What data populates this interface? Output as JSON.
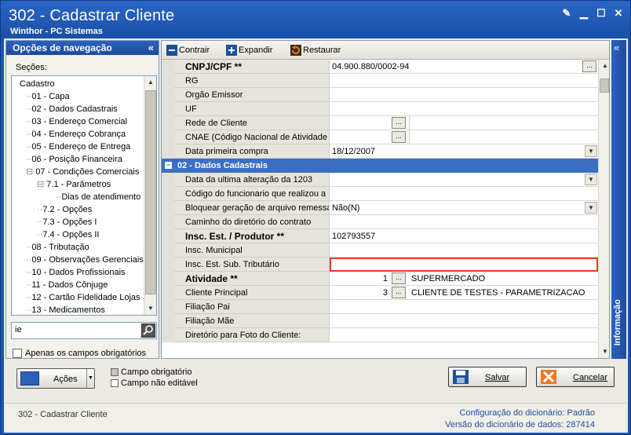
{
  "window": {
    "title": "302 - Cadastrar Cliente",
    "subtitle": "Winthor - PC Sistemas"
  },
  "nav": {
    "header": "Opções de navegação",
    "sections_label": "Seções:",
    "tree": [
      {
        "label": "Cadastro",
        "level": 0
      },
      {
        "label": "01 - Capa",
        "level": 1
      },
      {
        "label": "02 - Dados Cadastrais",
        "level": 1
      },
      {
        "label": "03 - Endereço Comercial",
        "level": 1
      },
      {
        "label": "04 - Endereço Cobrança",
        "level": 1
      },
      {
        "label": "05 - Endereço de Entrega",
        "level": 1
      },
      {
        "label": "06 - Posição Financeira",
        "level": 1
      },
      {
        "label": "07 - Condições Comerciais",
        "level": 1
      },
      {
        "label": "7.1 - Parâmetros",
        "level": 2
      },
      {
        "label": "Dias de atendimento",
        "level": 3
      },
      {
        "label": "7.2 - Opções",
        "level": 2
      },
      {
        "label": "7.3 - Opções I",
        "level": 2
      },
      {
        "label": "7.4 - Opções II",
        "level": 2
      },
      {
        "label": "08 - Tributação",
        "level": 1
      },
      {
        "label": "09 - Observações Gerenciais",
        "level": 1
      },
      {
        "label": "10 - Dados Profissionais",
        "level": 1
      },
      {
        "label": "11 - Dados Cônjuge",
        "level": 1
      },
      {
        "label": "12 - Cartão Fidelidade Lojas",
        "level": 1
      },
      {
        "label": "13 - Medicamentos",
        "level": 1
      }
    ],
    "search_value": "ie",
    "only_required_label": "Apenas os campos obrigatórios"
  },
  "toolbar": {
    "collapse": "Contrair",
    "expand": "Expandir",
    "restore": "Restaurar"
  },
  "grid": {
    "rows1": [
      {
        "label": "CNPJ/CPF **",
        "bold": true,
        "value": "04.900.880/0002-94",
        "ellipsis": true
      },
      {
        "label": "RG",
        "value": ""
      },
      {
        "label": "Orgão Emissor",
        "value": ""
      },
      {
        "label": "UF",
        "value": ""
      },
      {
        "label": "Rede de Cliente",
        "value": "",
        "ellipsis_mid": true
      },
      {
        "label": "CNAE (Código Nacional de Atividade Ec",
        "value": "",
        "ellipsis_mid": true
      },
      {
        "label": "Data primeira compra",
        "value": "18/12/2007",
        "dropdown": true
      }
    ],
    "section": "02 - Dados Cadastrais",
    "rows2": [
      {
        "label": "Data da ultima alteração da 1203",
        "value": "",
        "dropdown": true
      },
      {
        "label": "Código do funcionario que realizou a últ",
        "value": ""
      },
      {
        "label": "Bloquear geração de arquivo remessa",
        "value": "Não(N)",
        "dropdown": true
      },
      {
        "label": "Caminho do diretório do contrato",
        "value": ""
      },
      {
        "label": "Insc. Est. / Produtor **",
        "bold": true,
        "value": "102793557"
      },
      {
        "label": "Insc. Municipal",
        "value": ""
      },
      {
        "label": "Insc. Est. Sub. Tributário",
        "value": "",
        "highlight": true
      },
      {
        "label": "Atividade **",
        "bold": true,
        "code": "1",
        "value": "SUPERMERCADO"
      },
      {
        "label": "Cliente Principal",
        "code": "3",
        "value": "CLIENTE DE TESTES - PARAMETRIZACAO"
      },
      {
        "label": "Filiação Pai",
        "value": ""
      },
      {
        "label": "Filiação Mãe",
        "value": ""
      },
      {
        "label": "Diretório para Foto do Cliente:",
        "value": ""
      }
    ]
  },
  "info_panel": "Informação",
  "bottom": {
    "actions": "Ações",
    "legend_required": "Campo obrigatório",
    "legend_noneditable": "Campo não editável",
    "save": "Salvar",
    "cancel": "Cancelar"
  },
  "status": {
    "left": "302 - Cadastrar Cliente",
    "dict_config_label": "Configuração do dicionário:",
    "dict_config_value": "Padrão",
    "dict_version_label": "Versão do dicionário de dados:",
    "dict_version_value": "287414"
  },
  "colors": {
    "title_bar": "#1d56b0",
    "section": "#3a6fc4",
    "highlight": "#e04020"
  }
}
